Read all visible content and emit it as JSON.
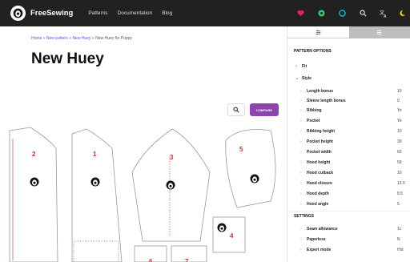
{
  "app": {
    "name": "FreeSewing"
  },
  "nav": {
    "items": [
      "Patterns",
      "Documentation",
      "Blog"
    ]
  },
  "topbar": {
    "icons": [
      "heart-icon",
      "patreon-icon",
      "github-icon",
      "search-icon",
      "translate-icon",
      "moon-icon"
    ]
  },
  "breadcrumb": {
    "items": [
      "Home",
      "New pattern",
      "New Huey"
    ],
    "current": "New Huey for Poppy",
    "separator": "»"
  },
  "page": {
    "title": "New Huey"
  },
  "toolbar": {
    "compare_label": "COMPARE"
  },
  "draft": {
    "pieces": [
      "2",
      "1",
      "3",
      "5",
      "4",
      "6",
      "7"
    ]
  },
  "sidebar": {
    "pattern_options_title": "PATTERN OPTIONS",
    "fit_label": "Fit",
    "style_label": "Style",
    "style_options": [
      {
        "label": "Length bonus",
        "value": "10"
      },
      {
        "label": "Sleeve length bonus",
        "value": "0"
      },
      {
        "label": "Ribbing",
        "value": "Ye"
      },
      {
        "label": "Pocket",
        "value": "Ye"
      },
      {
        "label": "Ribbing height",
        "value": "10"
      },
      {
        "label": "Pocket height",
        "value": "30"
      },
      {
        "label": "Pocket width",
        "value": "60"
      },
      {
        "label": "Hood height",
        "value": "59"
      },
      {
        "label": "Hood cutback",
        "value": "10"
      },
      {
        "label": "Hood closure",
        "value": "13.5"
      },
      {
        "label": "Hood depth",
        "value": "8.5"
      },
      {
        "label": "Hood angle",
        "value": "5"
      }
    ],
    "settings_title": "SETTINGS",
    "settings": [
      {
        "label": "Seam allowance",
        "value": "1c"
      },
      {
        "label": "Paperless",
        "value": "N"
      },
      {
        "label": "Expert mode",
        "value": "Hid"
      }
    ]
  },
  "colors": {
    "topbar": "#212121",
    "accent": "#8e44ad",
    "heart": "#e91e63",
    "patreon": "#2ecc71",
    "github": "#00bcd4",
    "moon": "#f1c40f",
    "piece_label": "#d32f2f"
  }
}
